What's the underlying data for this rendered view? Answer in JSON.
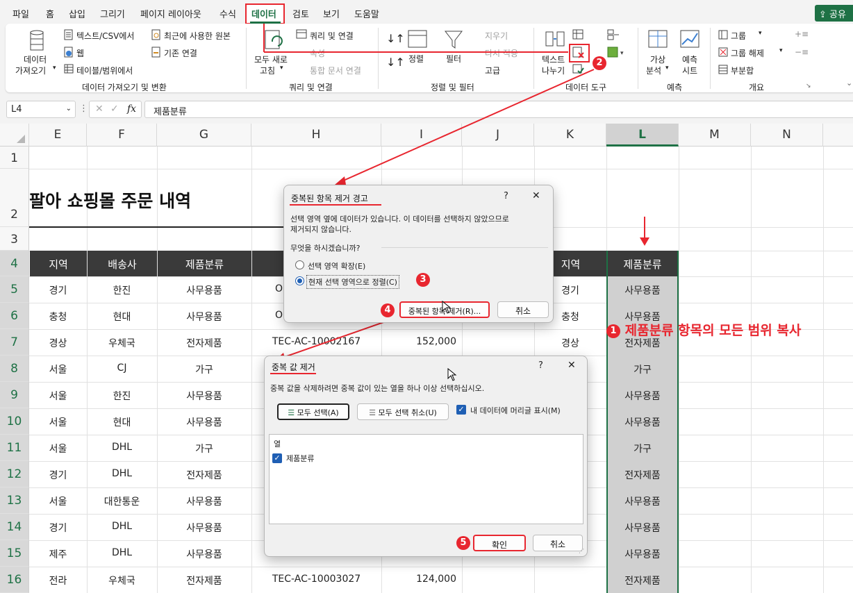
{
  "menu": {
    "tabs": [
      "파일",
      "홈",
      "삽입",
      "그리기",
      "페이지 레이아웃",
      "수식",
      "데이터",
      "검토",
      "보기",
      "도움말"
    ],
    "active_tab": "데이터",
    "share_label": "공유"
  },
  "ribbon": {
    "get_data": {
      "big_label_1": "데이터",
      "big_label_2": "가져오기",
      "text_csv": "텍스트/CSV에서",
      "web": "웹",
      "table_range": "테이블/범위에서",
      "recent_sources": "최근에 사용한 원본",
      "existing_connections": "기존 연결",
      "group_label": "데이터 가져오기 및 변환"
    },
    "queries": {
      "refresh_all_1": "모두 새로",
      "refresh_all_2": "고침",
      "queries_connections": "쿼리 및 연결",
      "properties": "속성",
      "edit_links": "통합 문서 연결",
      "group_label": "쿼리 및 연결"
    },
    "sort_filter": {
      "sort": "정렬",
      "filter": "필터",
      "clear": "지우기",
      "reapply": "다시 적용",
      "advanced": "고급",
      "group_label": "정렬 및 필터"
    },
    "data_tools": {
      "text_to_columns_1": "텍스트",
      "text_to_columns_2": "나누기",
      "group_label": "데이터 도구"
    },
    "forecast": {
      "what_if_1": "가상",
      "what_if_2": "분석",
      "forecast_sheet_1": "예측",
      "forecast_sheet_2": "시트",
      "group_label": "예측"
    },
    "outline": {
      "group": "그룹",
      "ungroup": "그룹 해제",
      "subtotal": "부분합",
      "group_label": "개요"
    }
  },
  "formula_bar": {
    "name_box": "L4",
    "fx": "fx",
    "formula": "제품분류"
  },
  "columns": [
    "E",
    "F",
    "G",
    "H",
    "I",
    "J",
    "K",
    "L",
    "M",
    "N"
  ],
  "selected_column": "L",
  "rows": [
    "1",
    "2",
    "3",
    "4",
    "5",
    "6",
    "7",
    "8",
    "9",
    "10",
    "11",
    "12",
    "13",
    "14",
    "15",
    "16"
  ],
  "sheet_title": "팔아 쇼핑몰 주문 내역",
  "table": {
    "headers": {
      "E": "지역",
      "F": "배송사",
      "G": "제품분류",
      "K": "지역",
      "L": "제품분류"
    },
    "rows": [
      {
        "E": "경기",
        "F": "한진",
        "G": "사무용품",
        "H": "O",
        "K": "경기",
        "L": "사무용품"
      },
      {
        "E": "충청",
        "F": "현대",
        "G": "사무용품",
        "H": "O",
        "K": "충청",
        "L": "사무용품"
      },
      {
        "E": "경상",
        "F": "우체국",
        "G": "전자제품",
        "H": "TEC-AC-10002167",
        "I": "152,000",
        "K": "경상",
        "L": "전자제품"
      },
      {
        "E": "서울",
        "F": "CJ",
        "G": "가구",
        "L": "가구"
      },
      {
        "E": "서울",
        "F": "한진",
        "G": "사무용품",
        "L": "사무용품"
      },
      {
        "E": "서울",
        "F": "현대",
        "G": "사무용품",
        "L": "사무용품"
      },
      {
        "E": "서울",
        "F": "DHL",
        "G": "가구",
        "L": "가구"
      },
      {
        "E": "경기",
        "F": "DHL",
        "G": "전자제품",
        "L": "전자제품"
      },
      {
        "E": "서울",
        "F": "대한통운",
        "G": "사무용품",
        "L": "사무용품"
      },
      {
        "E": "경기",
        "F": "DHL",
        "G": "사무용품",
        "L": "사무용품"
      },
      {
        "E": "제주",
        "F": "DHL",
        "G": "사무용품",
        "L": "사무용품"
      },
      {
        "E": "전라",
        "F": "우체국",
        "G": "전자제품",
        "H": "TEC-AC-10003027",
        "I": "124,000",
        "L": "전자제품"
      }
    ]
  },
  "annotations": {
    "step1_text": "제품분류 항목의 모든 범위 복사",
    "steps": [
      "1",
      "2",
      "3",
      "4",
      "5"
    ]
  },
  "warning_dialog": {
    "title": "중복된 항목 제거 경고",
    "help": "?",
    "close": "✕",
    "message_1": "선택 영역 옆에 데이터가 있습니다. 이 데이터를 선택하지 않았으므로",
    "message_2": "제거되지 않습니다.",
    "question": "무엇을 하시겠습니까?",
    "option_expand": "선택 영역 확장(E)",
    "option_current": "현재 선택 영역으로 정렬(C)",
    "remove_button": "중복된 항목 제거(R)...",
    "cancel_button": "취소"
  },
  "remove_dialog": {
    "title": "중복 값 제거",
    "help": "?",
    "close": "✕",
    "instruction": "중복 값을 삭제하려면 중복 값이 있는 열을 하나 이상 선택하십시오.",
    "select_all": "모두 선택(A)",
    "unselect_all": "모두 선택 취소(U)",
    "has_headers": "내 데이터에 머리글 표시(M)",
    "list_header": "열",
    "columns": [
      "제품분류"
    ],
    "ok_button": "확인",
    "cancel_button": "취소"
  },
  "colors": {
    "accent_red": "#e8262f",
    "excel_green": "#1e7145",
    "header_dark": "#3a3a3a",
    "selection_gray": "#d0d0d0"
  }
}
